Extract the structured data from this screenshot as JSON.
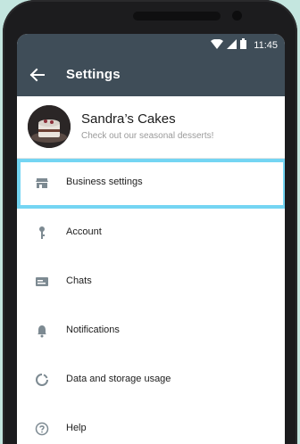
{
  "status_bar": {
    "time": "11:45",
    "icons": [
      "wifi-icon",
      "signal-icon",
      "battery-icon"
    ]
  },
  "app_bar": {
    "title": "Settings",
    "back_icon": "arrow-back-icon"
  },
  "profile": {
    "name": "Sandra’s Cakes",
    "status": "Check out our seasonal desserts!"
  },
  "menu": {
    "items": [
      {
        "label": "Business settings",
        "icon": "store-icon"
      },
      {
        "label": "Account",
        "icon": "key-icon"
      },
      {
        "label": "Chats",
        "icon": "chat-icon"
      },
      {
        "label": "Notifications",
        "icon": "bell-icon"
      },
      {
        "label": "Data and storage usage",
        "icon": "data-usage-icon"
      },
      {
        "label": "Help",
        "icon": "help-icon"
      }
    ]
  },
  "colors": {
    "app_bar": "#3f4d58",
    "highlight": "#74d5f3",
    "background": "#c4e6df",
    "icon": "#7d8a92"
  }
}
